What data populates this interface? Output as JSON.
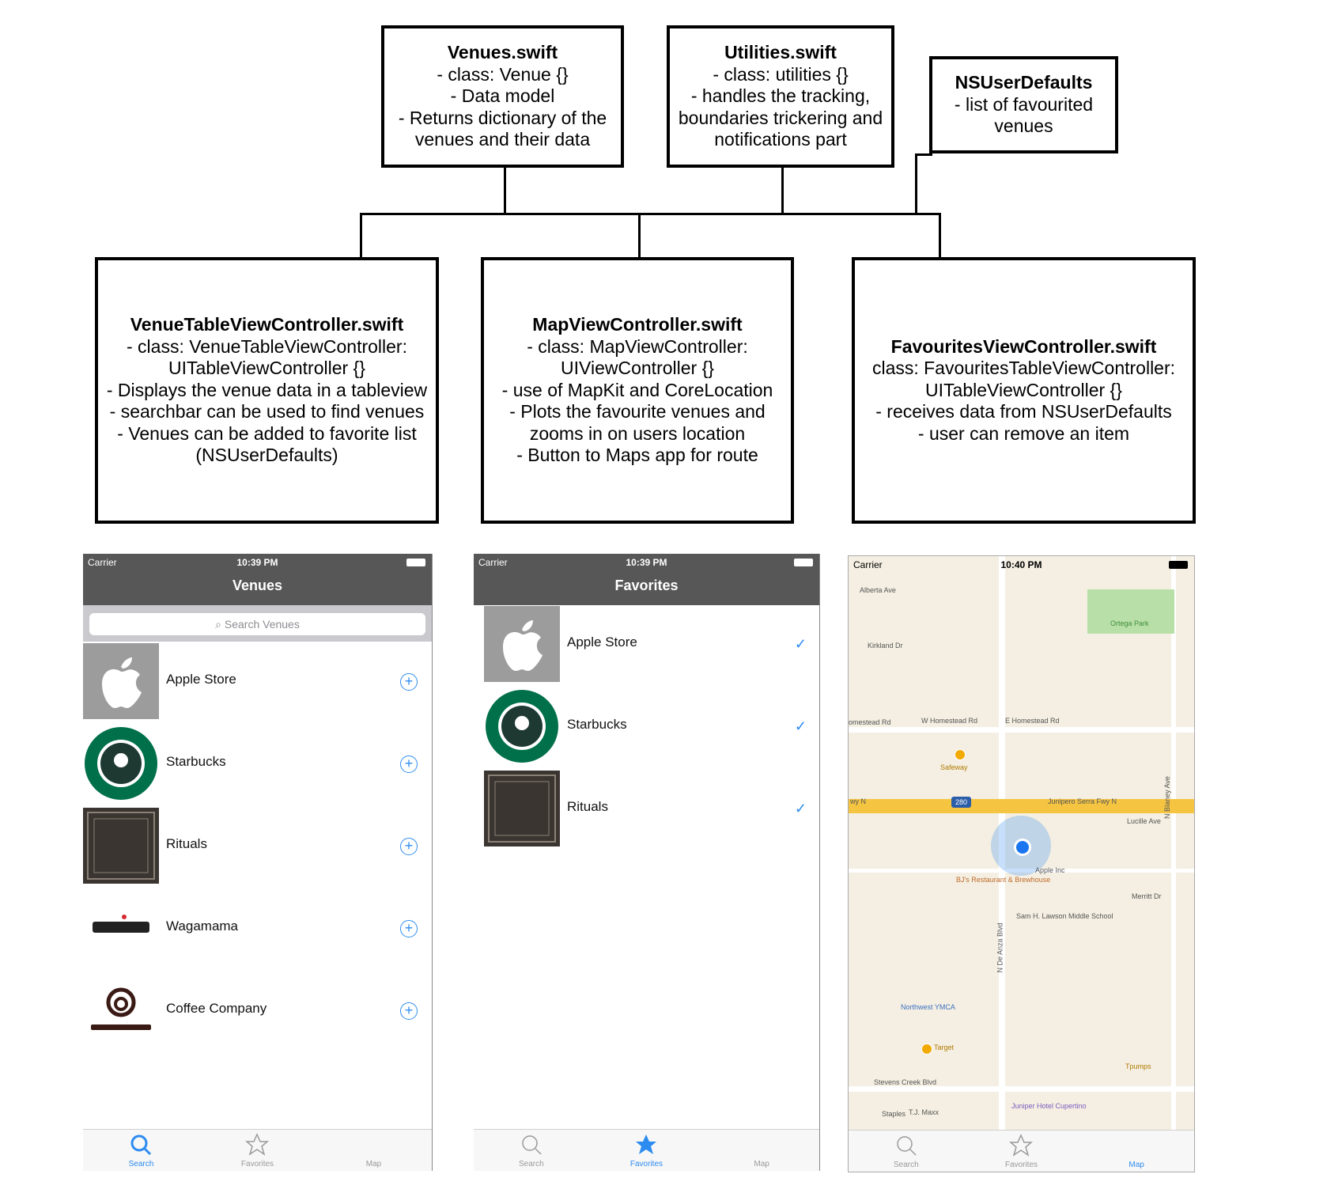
{
  "boxes": {
    "venues": {
      "title": "Venues.swift",
      "lines": [
        "- class: Venue {}",
        "- Data model",
        "- Returns dictionary of the",
        "venues and their data"
      ]
    },
    "utilities": {
      "title": "Utilities.swift",
      "lines": [
        "- class: utilities {}",
        "- handles the tracking,",
        "boundaries trickering and",
        "notifications part"
      ]
    },
    "defaults": {
      "title": "NSUserDefaults",
      "lines": [
        "- list of favourited",
        "venues"
      ]
    },
    "venuetable": {
      "title": "VenueTableViewController.swift",
      "lines": [
        "- class: VenueTableViewController:",
        "UITableViewController {}",
        "- Displays the venue data in a tableview",
        "- searchbar can be used to find venues",
        "- Venues can be added to favorite list",
        "(NSUserDefaults)"
      ]
    },
    "mapvc": {
      "title": "MapViewController.swift",
      "lines": [
        "- class: MapViewController:",
        "UIViewController {}",
        "- use of MapKit and CoreLocation",
        "- Plots the favourite venues and",
        "zooms in on users location",
        "- Button to Maps app for route"
      ]
    },
    "favvc": {
      "title": "FavouritesViewController.swift",
      "lines": [
        "class: FavouritesTableViewController:",
        "UITableViewController {}",
        "- receives data from NSUserDefaults",
        "- user can remove an item"
      ]
    }
  },
  "phones": {
    "venues": {
      "carrier": "Carrier",
      "time": "10:39 PM",
      "title": "Venues",
      "search_placeholder": "Search Venues",
      "rows": [
        "Apple Store",
        "Starbucks",
        "Rituals",
        "Wagamama",
        "Coffee Company"
      ],
      "add_icon": "plus-circle-icon"
    },
    "favorites": {
      "carrier": "Carrier",
      "time": "10:39 PM",
      "title": "Favorites",
      "rows": [
        "Apple Store",
        "Starbucks",
        "Rituals"
      ],
      "check_icon": "checkmark-icon"
    },
    "map": {
      "carrier": "Carrier",
      "time": "10:40 PM",
      "labels": {
        "alberta": "Alberta Ave",
        "kirkland": "Kirkland Dr",
        "ortega": "Ortega Park",
        "homestead_w": "W Homestead Rd",
        "homestead_e": "E Homestead Rd",
        "homestead_l": "omestead Rd",
        "safeway": "Safeway",
        "interstate": "280",
        "junipero": "Junipero Serra Fwy N",
        "fwy": "wy N",
        "lucille": "Lucille Ave",
        "bj": "BJ's Restaurant & Brewhouse",
        "apple": "Apple Inc",
        "merritt": "Merritt Dr",
        "lawson": "Sam H. Lawson Middle School",
        "ymca": "Northwest YMCA",
        "target": "Target",
        "stevens": "Stevens Creek Blvd",
        "juniper": "Juniper Hotel Cupertino",
        "staples": "Staples",
        "tjmaxx": "T.J. Maxx",
        "tpumps": "Tpumps",
        "deanza": "N De Anza Blvd",
        "blaney": "N Blaney Ave"
      }
    },
    "tabs": [
      "Search",
      "Favorites",
      "Map"
    ]
  }
}
